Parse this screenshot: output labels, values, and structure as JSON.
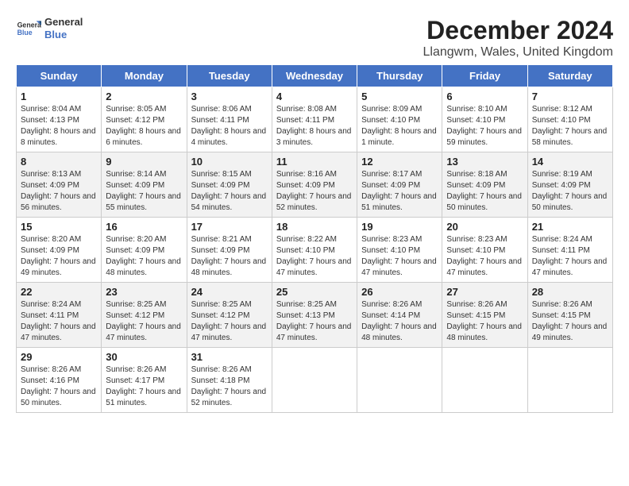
{
  "header": {
    "logo_line1": "General",
    "logo_line2": "Blue",
    "month": "December 2024",
    "location": "Llangwm, Wales, United Kingdom"
  },
  "days_of_week": [
    "Sunday",
    "Monday",
    "Tuesday",
    "Wednesday",
    "Thursday",
    "Friday",
    "Saturday"
  ],
  "weeks": [
    [
      {
        "day": "1",
        "sunrise": "8:04 AM",
        "sunset": "4:13 PM",
        "daylight": "8 hours and 8 minutes."
      },
      {
        "day": "2",
        "sunrise": "8:05 AM",
        "sunset": "4:12 PM",
        "daylight": "8 hours and 6 minutes."
      },
      {
        "day": "3",
        "sunrise": "8:06 AM",
        "sunset": "4:11 PM",
        "daylight": "8 hours and 4 minutes."
      },
      {
        "day": "4",
        "sunrise": "8:08 AM",
        "sunset": "4:11 PM",
        "daylight": "8 hours and 3 minutes."
      },
      {
        "day": "5",
        "sunrise": "8:09 AM",
        "sunset": "4:10 PM",
        "daylight": "8 hours and 1 minute."
      },
      {
        "day": "6",
        "sunrise": "8:10 AM",
        "sunset": "4:10 PM",
        "daylight": "7 hours and 59 minutes."
      },
      {
        "day": "7",
        "sunrise": "8:12 AM",
        "sunset": "4:10 PM",
        "daylight": "7 hours and 58 minutes."
      }
    ],
    [
      {
        "day": "8",
        "sunrise": "8:13 AM",
        "sunset": "4:09 PM",
        "daylight": "7 hours and 56 minutes."
      },
      {
        "day": "9",
        "sunrise": "8:14 AM",
        "sunset": "4:09 PM",
        "daylight": "7 hours and 55 minutes."
      },
      {
        "day": "10",
        "sunrise": "8:15 AM",
        "sunset": "4:09 PM",
        "daylight": "7 hours and 54 minutes."
      },
      {
        "day": "11",
        "sunrise": "8:16 AM",
        "sunset": "4:09 PM",
        "daylight": "7 hours and 52 minutes."
      },
      {
        "day": "12",
        "sunrise": "8:17 AM",
        "sunset": "4:09 PM",
        "daylight": "7 hours and 51 minutes."
      },
      {
        "day": "13",
        "sunrise": "8:18 AM",
        "sunset": "4:09 PM",
        "daylight": "7 hours and 50 minutes."
      },
      {
        "day": "14",
        "sunrise": "8:19 AM",
        "sunset": "4:09 PM",
        "daylight": "7 hours and 50 minutes."
      }
    ],
    [
      {
        "day": "15",
        "sunrise": "8:20 AM",
        "sunset": "4:09 PM",
        "daylight": "7 hours and 49 minutes."
      },
      {
        "day": "16",
        "sunrise": "8:20 AM",
        "sunset": "4:09 PM",
        "daylight": "7 hours and 48 minutes."
      },
      {
        "day": "17",
        "sunrise": "8:21 AM",
        "sunset": "4:09 PM",
        "daylight": "7 hours and 48 minutes."
      },
      {
        "day": "18",
        "sunrise": "8:22 AM",
        "sunset": "4:10 PM",
        "daylight": "7 hours and 47 minutes."
      },
      {
        "day": "19",
        "sunrise": "8:23 AM",
        "sunset": "4:10 PM",
        "daylight": "7 hours and 47 minutes."
      },
      {
        "day": "20",
        "sunrise": "8:23 AM",
        "sunset": "4:10 PM",
        "daylight": "7 hours and 47 minutes."
      },
      {
        "day": "21",
        "sunrise": "8:24 AM",
        "sunset": "4:11 PM",
        "daylight": "7 hours and 47 minutes."
      }
    ],
    [
      {
        "day": "22",
        "sunrise": "8:24 AM",
        "sunset": "4:11 PM",
        "daylight": "7 hours and 47 minutes."
      },
      {
        "day": "23",
        "sunrise": "8:25 AM",
        "sunset": "4:12 PM",
        "daylight": "7 hours and 47 minutes."
      },
      {
        "day": "24",
        "sunrise": "8:25 AM",
        "sunset": "4:12 PM",
        "daylight": "7 hours and 47 minutes."
      },
      {
        "day": "25",
        "sunrise": "8:25 AM",
        "sunset": "4:13 PM",
        "daylight": "7 hours and 47 minutes."
      },
      {
        "day": "26",
        "sunrise": "8:26 AM",
        "sunset": "4:14 PM",
        "daylight": "7 hours and 48 minutes."
      },
      {
        "day": "27",
        "sunrise": "8:26 AM",
        "sunset": "4:15 PM",
        "daylight": "7 hours and 48 minutes."
      },
      {
        "day": "28",
        "sunrise": "8:26 AM",
        "sunset": "4:15 PM",
        "daylight": "7 hours and 49 minutes."
      }
    ],
    [
      {
        "day": "29",
        "sunrise": "8:26 AM",
        "sunset": "4:16 PM",
        "daylight": "7 hours and 50 minutes."
      },
      {
        "day": "30",
        "sunrise": "8:26 AM",
        "sunset": "4:17 PM",
        "daylight": "7 hours and 51 minutes."
      },
      {
        "day": "31",
        "sunrise": "8:26 AM",
        "sunset": "4:18 PM",
        "daylight": "7 hours and 52 minutes."
      },
      null,
      null,
      null,
      null
    ]
  ],
  "labels": {
    "sunrise": "Sunrise:",
    "sunset": "Sunset:",
    "daylight": "Daylight:"
  },
  "colors": {
    "header_bg": "#4472c4",
    "accent_blue": "#1f4e79"
  }
}
